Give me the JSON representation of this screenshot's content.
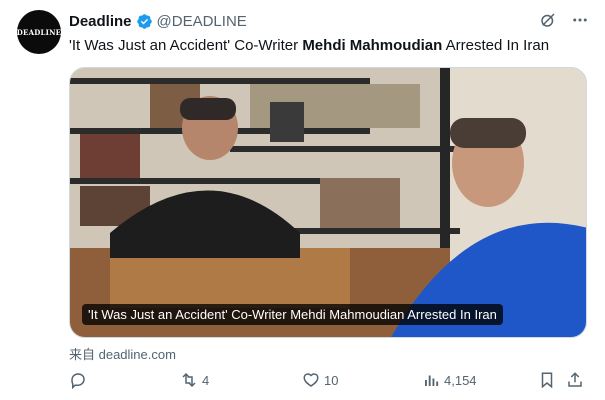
{
  "author": {
    "name": "Deadline",
    "handle": "@DEADLINE",
    "avatar_text": "DEADLINE",
    "verified_color": "#1d9bf0"
  },
  "tweet": {
    "text_before": "'It Was Just an Accident' Co-Writer ",
    "text_bold": "Mehdi Mahmoudian",
    "text_after": " Arrested In Iran"
  },
  "card": {
    "caption": "'It Was Just an Accident' Co-Writer Mehdi Mahmoudian Arrested In Iran",
    "source": "来自 deadline.com"
  },
  "actions": {
    "reply_icon": "reply-icon",
    "retweet_count": "4",
    "like_count": "10",
    "views_count": "4,154"
  },
  "colors": {
    "text_primary": "#0f1419",
    "text_secondary": "#536471",
    "accent": "#1d9bf0"
  }
}
